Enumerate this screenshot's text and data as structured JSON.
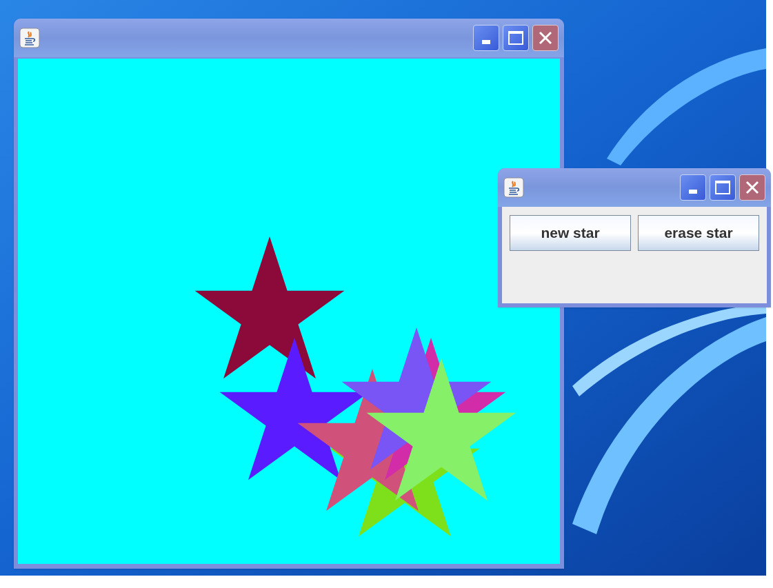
{
  "main_window": {
    "canvas": {
      "stars": [
        {
          "color": "#8b0a3a"
        },
        {
          "color": "#5a1cff"
        },
        {
          "color": "#7ee01a"
        },
        {
          "color": "#d0527a"
        },
        {
          "color": "#d22ca8"
        },
        {
          "color": "#7a55f5"
        },
        {
          "color": "#85f068"
        }
      ]
    }
  },
  "control_window": {
    "buttons": [
      {
        "label": "new star"
      },
      {
        "label": "erase star"
      }
    ]
  }
}
